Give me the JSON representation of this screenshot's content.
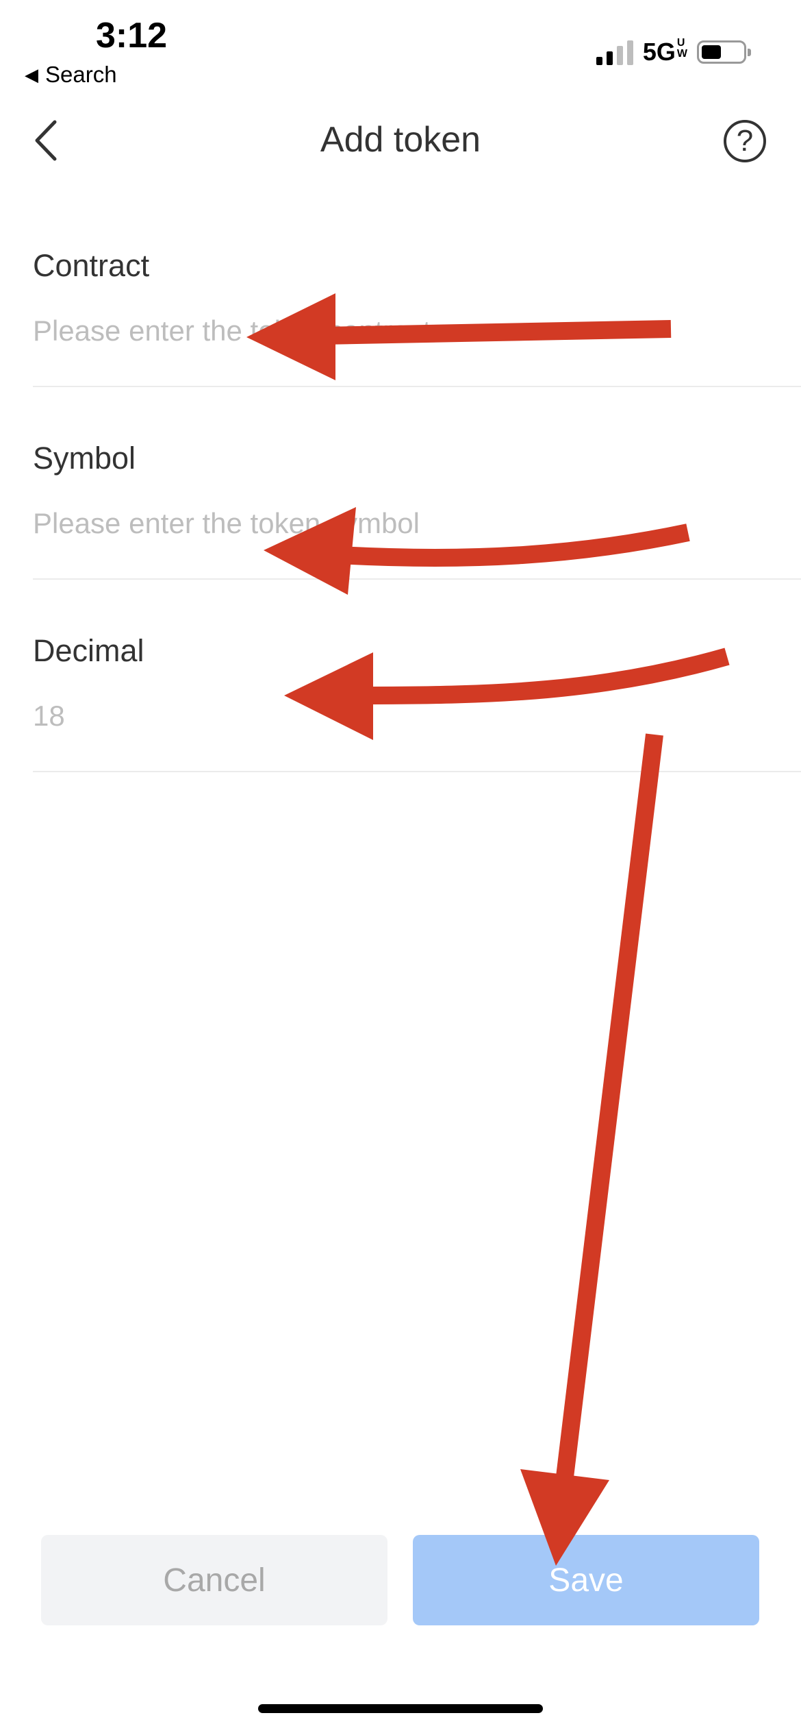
{
  "status_bar": {
    "time": "3:12",
    "back_app": "Search",
    "network": "5G",
    "network_badge": [
      "U",
      "W"
    ],
    "icons": [
      "signal-bars-icon",
      "battery-icon"
    ]
  },
  "nav": {
    "title": "Add token",
    "back_icon": "chevron-left-icon",
    "help_icon": "question-circle-icon",
    "help_glyph": "?"
  },
  "form": {
    "contract": {
      "label": "Contract",
      "placeholder": "Please enter the token contract",
      "value": ""
    },
    "symbol": {
      "label": "Symbol",
      "placeholder": "Please enter the token symbol",
      "value": ""
    },
    "decimal": {
      "label": "Decimal",
      "placeholder": "18",
      "value": ""
    }
  },
  "actions": {
    "cancel_label": "Cancel",
    "save_label": "Save"
  },
  "colors": {
    "annotation_arrow": "#d23a24",
    "save_button": "#a4c8f8",
    "cancel_button": "#f2f3f5",
    "placeholder": "#bdbdbd"
  }
}
